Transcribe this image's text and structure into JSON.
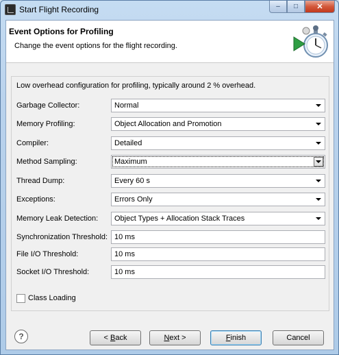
{
  "window": {
    "title": "Start Flight Recording",
    "minimize": "–",
    "maximize": "□",
    "close": "✕"
  },
  "header": {
    "title": "Event Options for Profiling",
    "description": "Change the event options for the flight recording."
  },
  "group": {
    "description": "Low overhead configuration for profiling, typically around 2 % overhead.",
    "fields": {
      "garbage_collector": {
        "label": "Garbage Collector:",
        "value": "Normal"
      },
      "memory_profiling": {
        "label": "Memory Profiling:",
        "value": "Object Allocation and Promotion"
      },
      "compiler": {
        "label": "Compiler:",
        "value": "Detailed"
      },
      "method_sampling": {
        "label": "Method Sampling:",
        "value": "Maximum"
      },
      "thread_dump": {
        "label": "Thread Dump:",
        "value": "Every 60 s"
      },
      "exceptions": {
        "label": "Exceptions:",
        "value": "Errors Only"
      },
      "memory_leak_detection": {
        "label": "Memory Leak Detection:",
        "value": "Object Types + Allocation Stack Traces"
      },
      "sync_threshold": {
        "label": "Synchronization Threshold:",
        "value": "10 ms"
      },
      "file_io_threshold": {
        "label": "File I/O Threshold:",
        "value": "10 ms"
      },
      "socket_io_threshold": {
        "label": "Socket I/O Threshold:",
        "value": "10 ms"
      }
    },
    "class_loading": {
      "label": "Class Loading",
      "checked": false
    }
  },
  "buttons": {
    "help": "?",
    "back_prefix": "< ",
    "back_mnemonic": "B",
    "back_rest": "ack",
    "next_mnemonic": "N",
    "next_rest": "ext >",
    "finish_mnemonic": "F",
    "finish_rest": "inish",
    "cancel": "Cancel"
  },
  "icons": {
    "app": "java-mission-control-icon",
    "wizard": "stopwatch-recording-icon",
    "help": "help-icon"
  }
}
